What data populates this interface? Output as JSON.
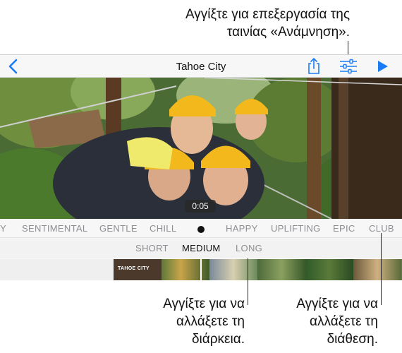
{
  "callouts": {
    "top_line1": "Αγγίξτε για επεξεργασία της",
    "top_line2": "ταινίας «Ανάμνηση».",
    "duration_line1": "Αγγίξτε για να",
    "duration_line2": "αλλάξετε τη",
    "duration_line3": "διάρκεια.",
    "mood_line1": "Αγγίξτε για να",
    "mood_line2": "αλλάξετε τη",
    "mood_line3": "διάθεση."
  },
  "navbar": {
    "title": "Tahoe City",
    "back_icon": "chevron-left-icon",
    "share_icon": "share-icon",
    "settings_icon": "sliders-icon",
    "play_icon": "play-icon",
    "accent": "#1a7cf5"
  },
  "preview": {
    "time": "0:05"
  },
  "moods": [
    "Y",
    "SENTIMENTAL",
    "GENTLE",
    "CHILL",
    "HAPPY",
    "UPLIFTING",
    "EPIC",
    "CLUB"
  ],
  "durations": [
    "SHORT",
    "MEDIUM",
    "LONG"
  ],
  "selected_duration": "MEDIUM",
  "timeline": {
    "title_frame_text": "TAHOE CITY"
  }
}
